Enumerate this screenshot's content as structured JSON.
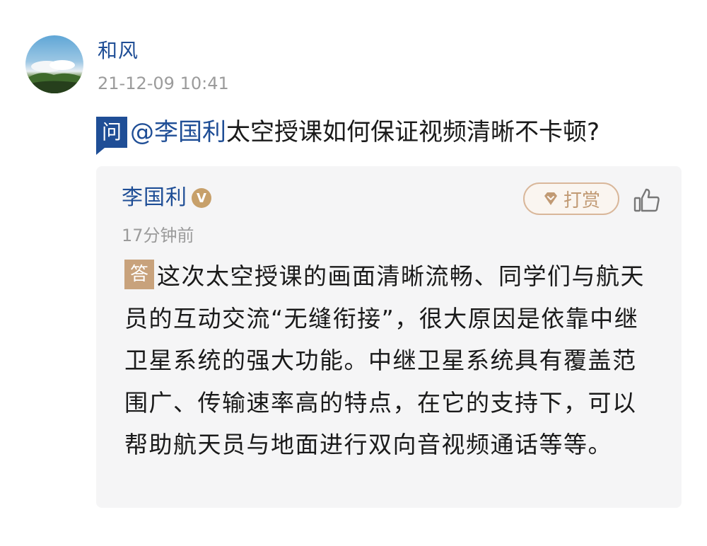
{
  "question": {
    "asker_name": "和风",
    "timestamp": "21-12-09 10:41",
    "badge": "问",
    "mention": "@李国利",
    "text": "太空授课如何保证视频清晰不卡顿?"
  },
  "answer": {
    "answerer_name": "李国利",
    "verified_label": "V",
    "time_ago": "17分钟前",
    "tip_label": "打赏",
    "badge": "答",
    "text": "这次太空授课的画面清晰流畅、同学们与航天员的互动交流“无缝衔接”，很大原因是依靠中继卫星系统的强大功能。中继卫星系统具有覆盖范围广、传输速率高的特点，在它的支持下，可以帮助航天员与地面进行双向音视频通话等等。"
  },
  "icons": {
    "avatar": "landscape-avatar",
    "verified": "verified-v-icon",
    "tip": "gem-icon",
    "like": "thumbs-up-icon"
  },
  "colors": {
    "accent_blue": "#1f4e96",
    "answer_badge": "#c8a27c",
    "tip_border": "#d9b79a",
    "muted_text": "#9b9b9b",
    "card_bg": "#f5f5f6"
  }
}
